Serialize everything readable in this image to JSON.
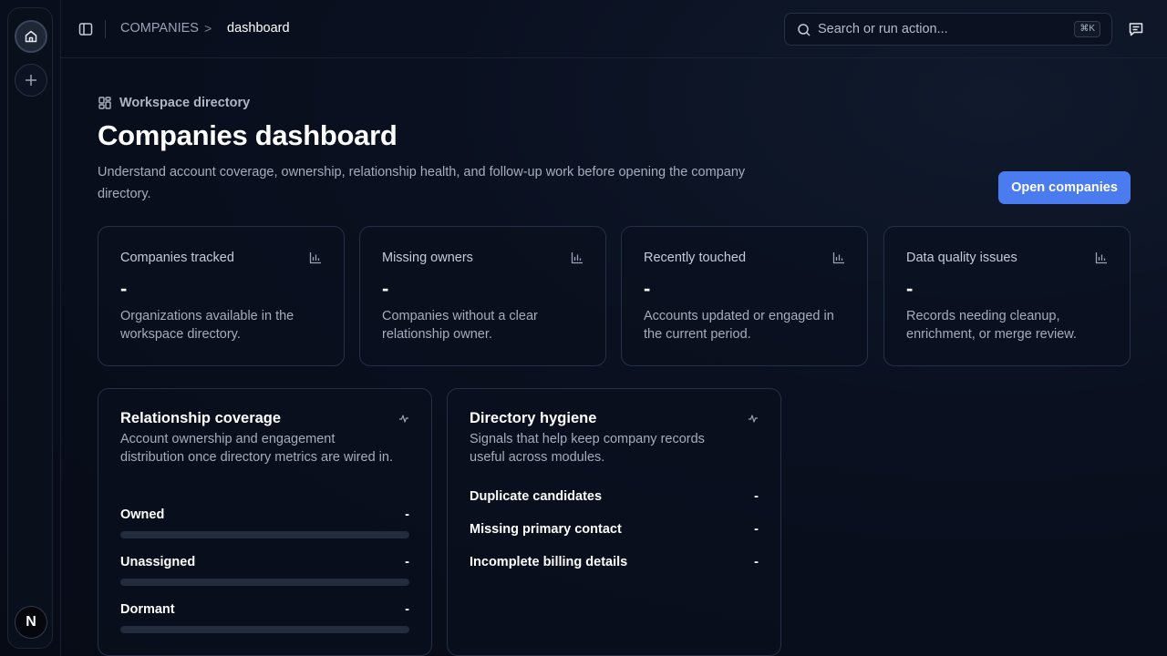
{
  "breadcrumb": {
    "section": "COMPANIES",
    "separator": ">",
    "page": "dashboard"
  },
  "search": {
    "placeholder": "Search or run action...",
    "shortcut": "⌘K"
  },
  "rail": {
    "avatar_letter": "N"
  },
  "header": {
    "eyebrow": "Workspace directory",
    "title": "Companies dashboard",
    "subtitle": "Understand account coverage, ownership, relationship health, and follow-up work before opening the company directory.",
    "primary_action": "Open companies"
  },
  "stats": [
    {
      "label": "Companies tracked",
      "value": "-",
      "description": "Organizations available in the workspace directory."
    },
    {
      "label": "Missing owners",
      "value": "-",
      "description": "Companies without a clear relationship owner."
    },
    {
      "label": "Recently touched",
      "value": "-",
      "description": "Accounts updated or engaged in the current period."
    },
    {
      "label": "Data quality issues",
      "value": "-",
      "description": "Records needing cleanup, enrichment, or merge review."
    }
  ],
  "coverage": {
    "title": "Relationship coverage",
    "description": "Account ownership and engagement distribution once directory metrics are wired in.",
    "rows": [
      {
        "label": "Owned",
        "value": "-",
        "fill": 0
      },
      {
        "label": "Unassigned",
        "value": "-",
        "fill": 0
      },
      {
        "label": "Dormant",
        "value": "-",
        "fill": 0
      }
    ]
  },
  "hygiene": {
    "title": "Directory hygiene",
    "description": "Signals that help keep company records useful across modules.",
    "rows": [
      {
        "label": "Duplicate candidates",
        "value": "-"
      },
      {
        "label": "Missing primary contact",
        "value": "-"
      },
      {
        "label": "Incomplete billing details",
        "value": "-"
      }
    ]
  },
  "colors": {
    "accent": "#4a7cf0",
    "background": "#080d1a",
    "card_border": "#243048"
  }
}
